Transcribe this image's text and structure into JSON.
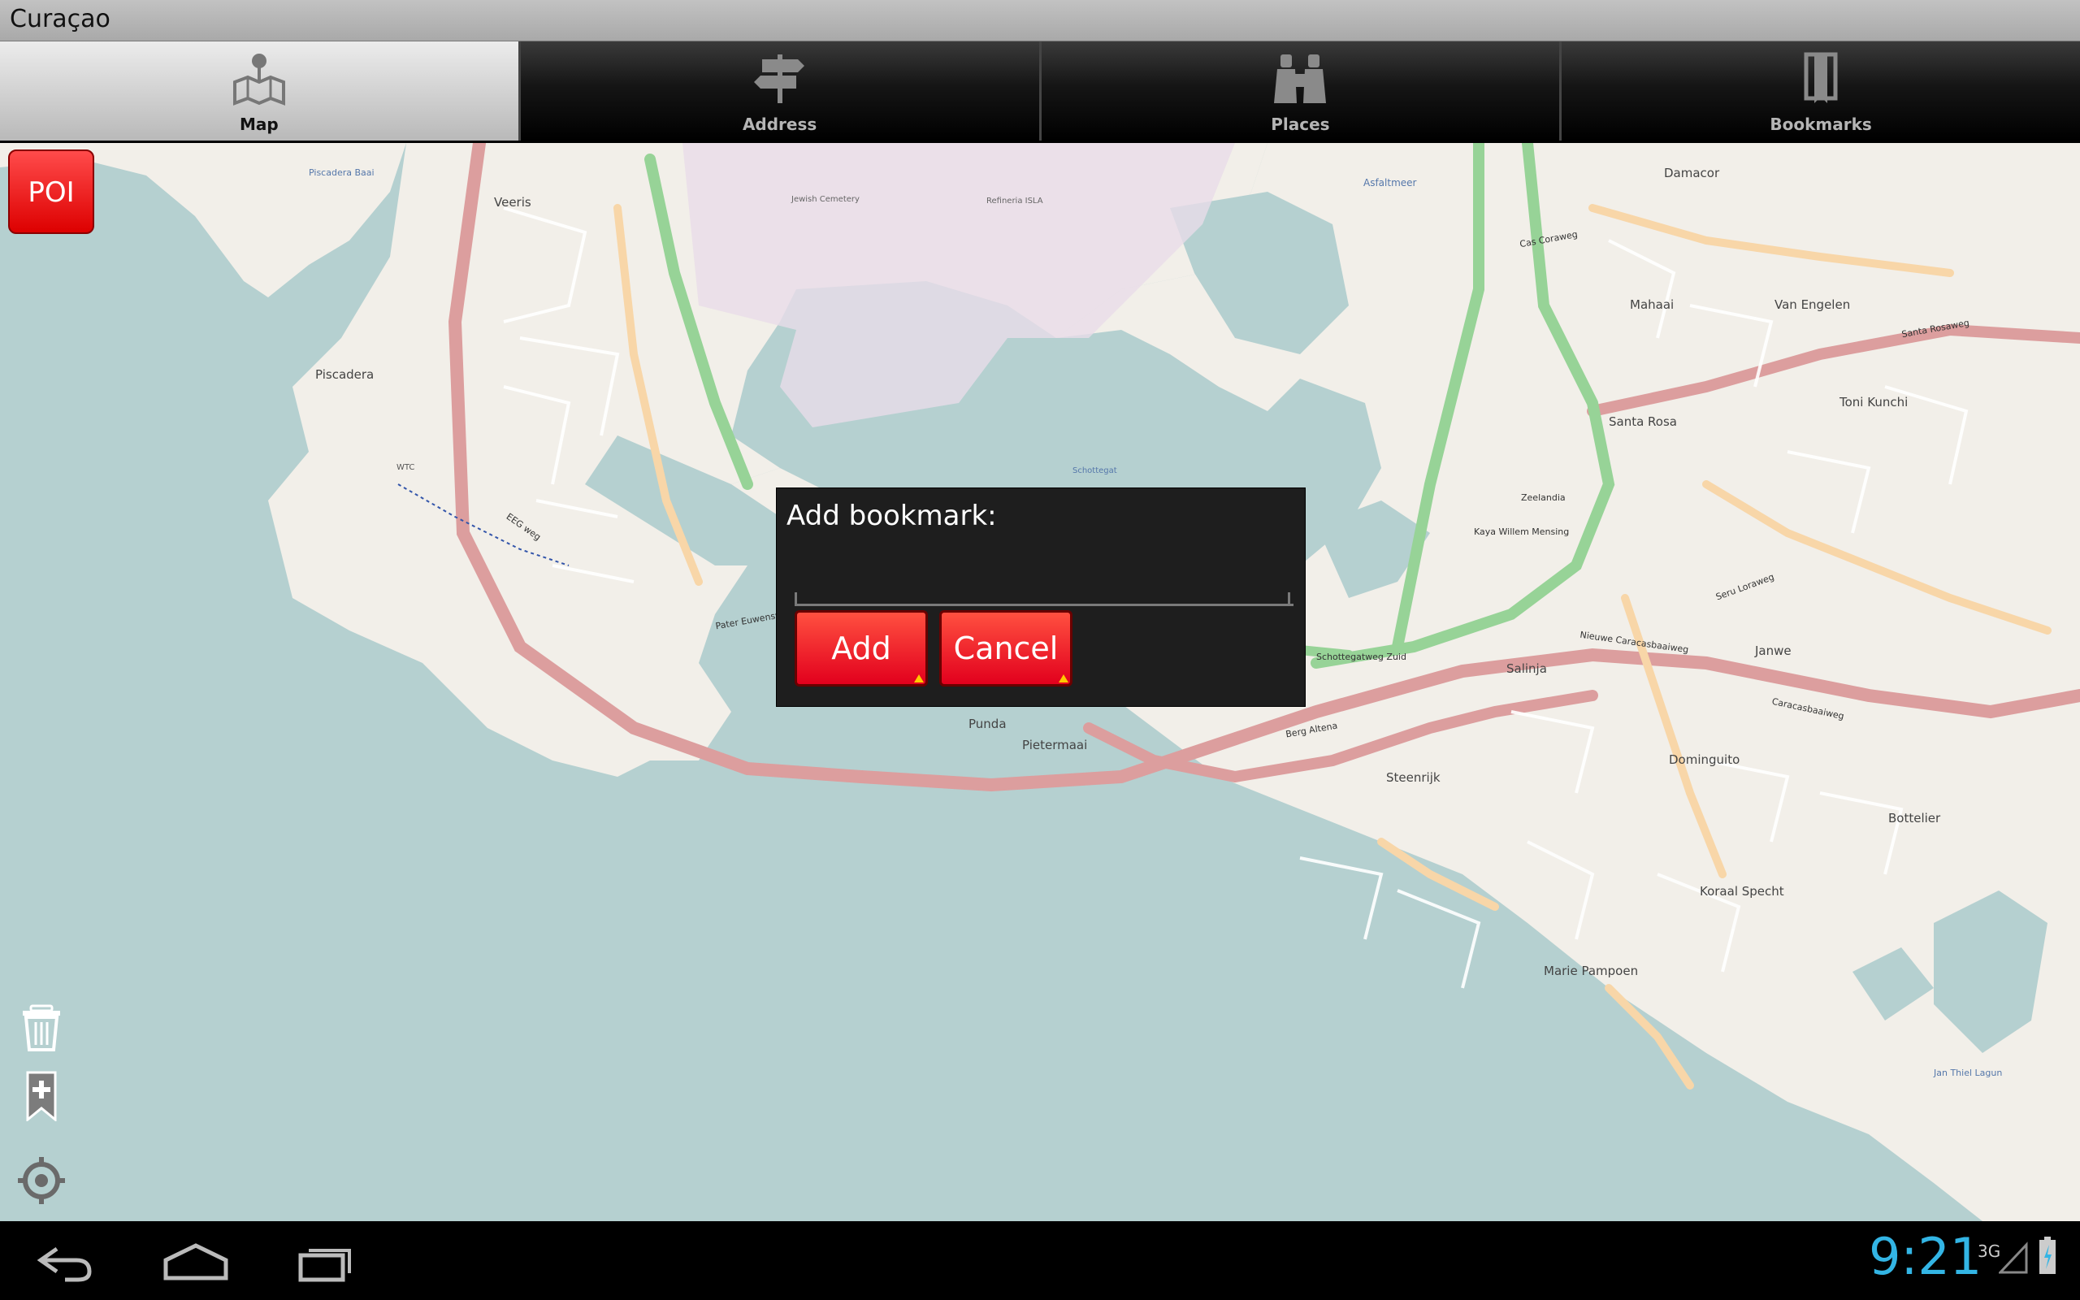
{
  "window": {
    "title": "Curaçao"
  },
  "tabs": [
    {
      "label": "Map",
      "icon": "map-pin-icon",
      "active": true
    },
    {
      "label": "Address",
      "icon": "signpost-icon",
      "active": false
    },
    {
      "label": "Places",
      "icon": "binoculars-icon",
      "active": false
    },
    {
      "label": "Bookmarks",
      "icon": "bookmark-icon",
      "active": false
    }
  ],
  "map": {
    "poi_button": "POI",
    "controls": [
      "trash-icon",
      "add-bookmark-icon",
      "my-location-icon"
    ],
    "labels": {
      "veeris": "Veeris",
      "piscadera": "Piscadera",
      "piscadera_baai": "Piscadera Baai",
      "asfaltmeer": "Asfaltmeer",
      "damacor": "Damacor",
      "mahaai": "Mahaai",
      "van_engelen": "Van Engelen",
      "santa_rosa": "Santa Rosa",
      "toni_kunchi": "Toni Kunchi",
      "santa_rosaweg": "Santa Rosaweg",
      "cas_coraweg": "Cas Coraweg",
      "seru_loraweg": "Seru Loraweg",
      "janwe": "Janwe",
      "salinja": "Salinja",
      "caracasbaaiweg": "Caracasbaaiweg",
      "nieuwe_caracasbaaiweg": "Nieuwe Caracasbaaiweg",
      "dominguito": "Dominguito",
      "bottelier": "Bottelier",
      "koraal_specht": "Koraal Specht",
      "steenrijk": "Steenrijk",
      "marie_pampoen": "Marie Pampoen",
      "punda": "Punda",
      "pietermaai": "Pietermaai",
      "berg_altena": "Berg Altena",
      "schottegatweg_zuid": "Schottegatweg Zuid",
      "zeelandia": "Zeelandia",
      "kaya_willem_mensing": "Kaya Willem Mensing",
      "pater_euwensweg": "Pater Euwensweg",
      "eeg_weg": "EEG weg",
      "refineria_isla": "Refineria ISLA",
      "jewish_cemetery": "Jewish Cemetery",
      "schottegat": "Schottegat",
      "spanish_water": "Jan Thiel Lagun",
      "wtc": "WTC"
    }
  },
  "dialog": {
    "title": "Add bookmark:",
    "input_value": "",
    "add_label": "Add",
    "cancel_label": "Cancel"
  },
  "navbar": {
    "buttons": [
      "back-icon",
      "home-icon",
      "recent-apps-icon"
    ],
    "time": "9:21",
    "network": "3G"
  },
  "colors": {
    "accent_red": "#e2001d",
    "clock_blue": "#33b5e5",
    "sea": "#b5d0d0",
    "land": "#f2efe9",
    "primary_road": "#dc9e9e",
    "secondary_road": "#f8d6a8",
    "trunk_road": "#97d397"
  }
}
